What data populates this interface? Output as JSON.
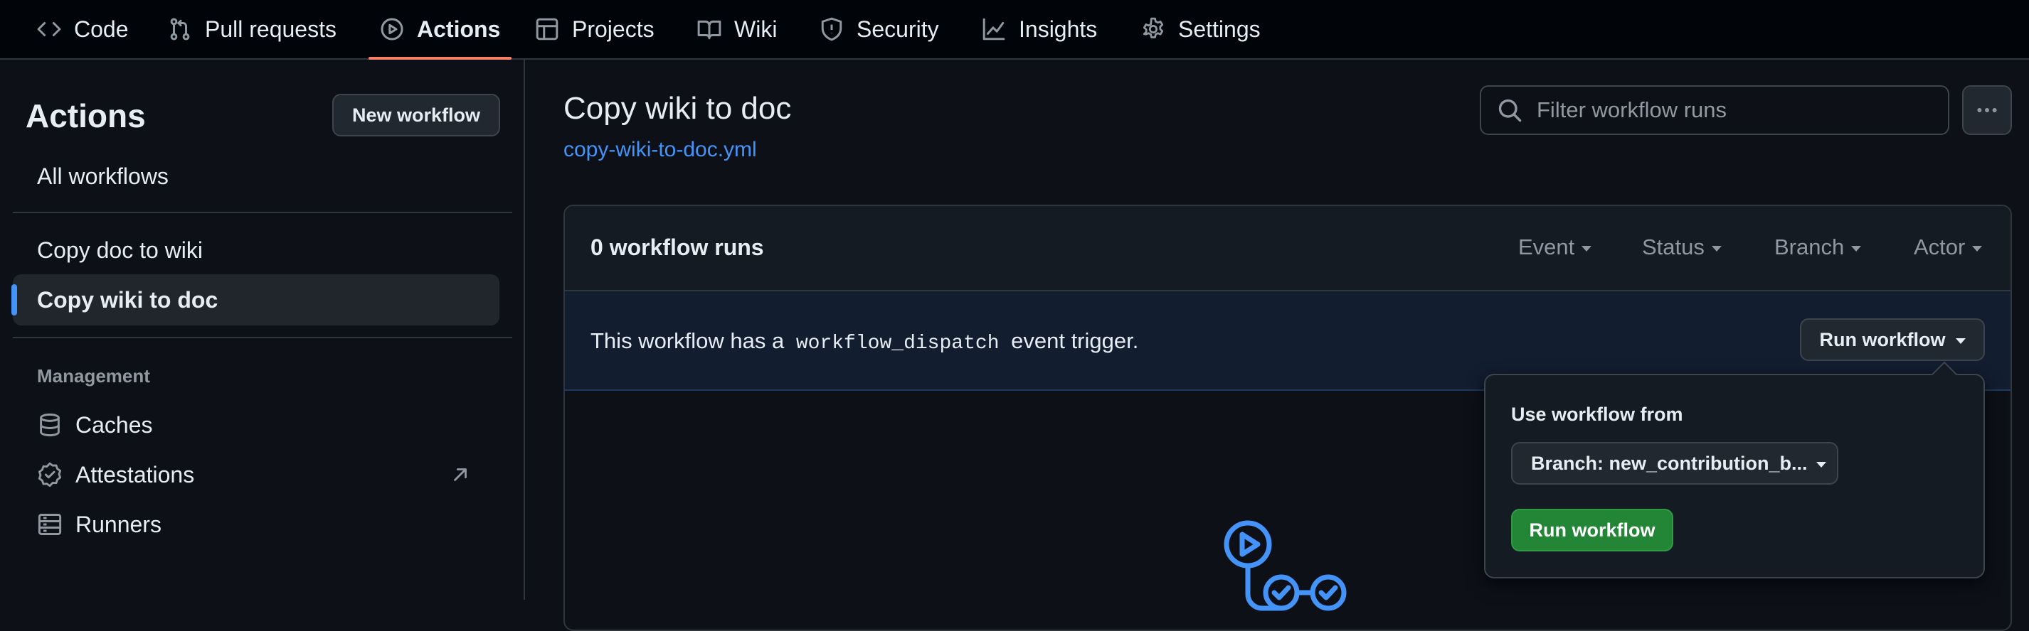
{
  "nav": {
    "tabs": [
      {
        "label": "Code",
        "icon": "code-icon"
      },
      {
        "label": "Pull requests",
        "icon": "pull-request-icon"
      },
      {
        "label": "Actions",
        "icon": "play-icon",
        "active": true
      },
      {
        "label": "Projects",
        "icon": "table-icon"
      },
      {
        "label": "Wiki",
        "icon": "book-icon"
      },
      {
        "label": "Security",
        "icon": "shield-icon"
      },
      {
        "label": "Insights",
        "icon": "graph-icon"
      },
      {
        "label": "Settings",
        "icon": "gear-icon"
      }
    ]
  },
  "sidebar": {
    "title": "Actions",
    "new_workflow_label": "New workflow",
    "all_workflows_label": "All workflows",
    "workflows": [
      {
        "label": "Copy doc to wiki"
      },
      {
        "label": "Copy wiki to doc",
        "selected": true
      }
    ],
    "management": {
      "heading": "Management",
      "items": [
        {
          "label": "Caches",
          "icon": "database-icon"
        },
        {
          "label": "Attestations",
          "icon": "verified-icon",
          "external": true
        },
        {
          "label": "Runners",
          "icon": "server-icon"
        }
      ]
    }
  },
  "main": {
    "title": "Copy wiki to doc",
    "file_link": "copy-wiki-to-doc.yml",
    "search_placeholder": "Filter workflow runs",
    "runs": {
      "count_label": "0 workflow runs",
      "filters": [
        "Event",
        "Status",
        "Branch",
        "Actor"
      ]
    },
    "dispatch": {
      "prefix": "This workflow has a",
      "code": "workflow_dispatch",
      "suffix": "event trigger.",
      "run_button_label": "Run workflow"
    }
  },
  "dropdown": {
    "label": "Use workflow from",
    "branch_label": "Branch: new_contribution_b...",
    "run_button_label": "Run workflow"
  },
  "colors": {
    "accent": "#4493f8",
    "active_tab_underline": "#f78166",
    "primary_button": "#238636"
  }
}
